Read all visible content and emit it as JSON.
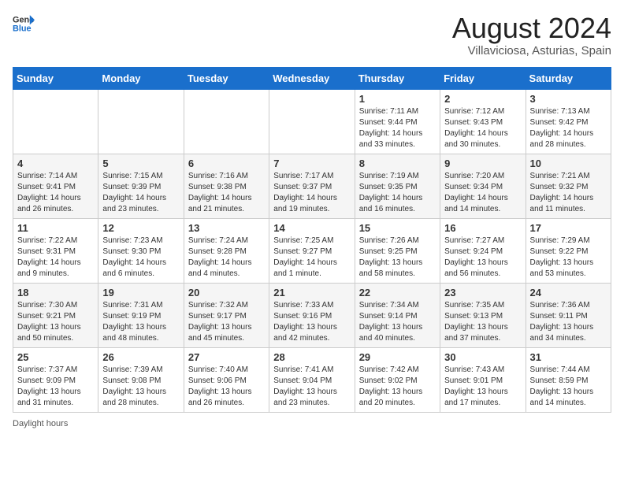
{
  "header": {
    "logo_general": "General",
    "logo_blue": "Blue",
    "month_year": "August 2024",
    "location": "Villaviciosa, Asturias, Spain"
  },
  "weekdays": [
    "Sunday",
    "Monday",
    "Tuesday",
    "Wednesday",
    "Thursday",
    "Friday",
    "Saturday"
  ],
  "footer_label": "Daylight hours",
  "weeks": [
    [
      {
        "day": "",
        "sunrise": "",
        "sunset": "",
        "daylight": ""
      },
      {
        "day": "",
        "sunrise": "",
        "sunset": "",
        "daylight": ""
      },
      {
        "day": "",
        "sunrise": "",
        "sunset": "",
        "daylight": ""
      },
      {
        "day": "",
        "sunrise": "",
        "sunset": "",
        "daylight": ""
      },
      {
        "day": "1",
        "sunrise": "Sunrise: 7:11 AM",
        "sunset": "Sunset: 9:44 PM",
        "daylight": "Daylight: 14 hours and 33 minutes."
      },
      {
        "day": "2",
        "sunrise": "Sunrise: 7:12 AM",
        "sunset": "Sunset: 9:43 PM",
        "daylight": "Daylight: 14 hours and 30 minutes."
      },
      {
        "day": "3",
        "sunrise": "Sunrise: 7:13 AM",
        "sunset": "Sunset: 9:42 PM",
        "daylight": "Daylight: 14 hours and 28 minutes."
      }
    ],
    [
      {
        "day": "4",
        "sunrise": "Sunrise: 7:14 AM",
        "sunset": "Sunset: 9:41 PM",
        "daylight": "Daylight: 14 hours and 26 minutes."
      },
      {
        "day": "5",
        "sunrise": "Sunrise: 7:15 AM",
        "sunset": "Sunset: 9:39 PM",
        "daylight": "Daylight: 14 hours and 23 minutes."
      },
      {
        "day": "6",
        "sunrise": "Sunrise: 7:16 AM",
        "sunset": "Sunset: 9:38 PM",
        "daylight": "Daylight: 14 hours and 21 minutes."
      },
      {
        "day": "7",
        "sunrise": "Sunrise: 7:17 AM",
        "sunset": "Sunset: 9:37 PM",
        "daylight": "Daylight: 14 hours and 19 minutes."
      },
      {
        "day": "8",
        "sunrise": "Sunrise: 7:19 AM",
        "sunset": "Sunset: 9:35 PM",
        "daylight": "Daylight: 14 hours and 16 minutes."
      },
      {
        "day": "9",
        "sunrise": "Sunrise: 7:20 AM",
        "sunset": "Sunset: 9:34 PM",
        "daylight": "Daylight: 14 hours and 14 minutes."
      },
      {
        "day": "10",
        "sunrise": "Sunrise: 7:21 AM",
        "sunset": "Sunset: 9:32 PM",
        "daylight": "Daylight: 14 hours and 11 minutes."
      }
    ],
    [
      {
        "day": "11",
        "sunrise": "Sunrise: 7:22 AM",
        "sunset": "Sunset: 9:31 PM",
        "daylight": "Daylight: 14 hours and 9 minutes."
      },
      {
        "day": "12",
        "sunrise": "Sunrise: 7:23 AM",
        "sunset": "Sunset: 9:30 PM",
        "daylight": "Daylight: 14 hours and 6 minutes."
      },
      {
        "day": "13",
        "sunrise": "Sunrise: 7:24 AM",
        "sunset": "Sunset: 9:28 PM",
        "daylight": "Daylight: 14 hours and 4 minutes."
      },
      {
        "day": "14",
        "sunrise": "Sunrise: 7:25 AM",
        "sunset": "Sunset: 9:27 PM",
        "daylight": "Daylight: 14 hours and 1 minute."
      },
      {
        "day": "15",
        "sunrise": "Sunrise: 7:26 AM",
        "sunset": "Sunset: 9:25 PM",
        "daylight": "Daylight: 13 hours and 58 minutes."
      },
      {
        "day": "16",
        "sunrise": "Sunrise: 7:27 AM",
        "sunset": "Sunset: 9:24 PM",
        "daylight": "Daylight: 13 hours and 56 minutes."
      },
      {
        "day": "17",
        "sunrise": "Sunrise: 7:29 AM",
        "sunset": "Sunset: 9:22 PM",
        "daylight": "Daylight: 13 hours and 53 minutes."
      }
    ],
    [
      {
        "day": "18",
        "sunrise": "Sunrise: 7:30 AM",
        "sunset": "Sunset: 9:21 PM",
        "daylight": "Daylight: 13 hours and 50 minutes."
      },
      {
        "day": "19",
        "sunrise": "Sunrise: 7:31 AM",
        "sunset": "Sunset: 9:19 PM",
        "daylight": "Daylight: 13 hours and 48 minutes."
      },
      {
        "day": "20",
        "sunrise": "Sunrise: 7:32 AM",
        "sunset": "Sunset: 9:17 PM",
        "daylight": "Daylight: 13 hours and 45 minutes."
      },
      {
        "day": "21",
        "sunrise": "Sunrise: 7:33 AM",
        "sunset": "Sunset: 9:16 PM",
        "daylight": "Daylight: 13 hours and 42 minutes."
      },
      {
        "day": "22",
        "sunrise": "Sunrise: 7:34 AM",
        "sunset": "Sunset: 9:14 PM",
        "daylight": "Daylight: 13 hours and 40 minutes."
      },
      {
        "day": "23",
        "sunrise": "Sunrise: 7:35 AM",
        "sunset": "Sunset: 9:13 PM",
        "daylight": "Daylight: 13 hours and 37 minutes."
      },
      {
        "day": "24",
        "sunrise": "Sunrise: 7:36 AM",
        "sunset": "Sunset: 9:11 PM",
        "daylight": "Daylight: 13 hours and 34 minutes."
      }
    ],
    [
      {
        "day": "25",
        "sunrise": "Sunrise: 7:37 AM",
        "sunset": "Sunset: 9:09 PM",
        "daylight": "Daylight: 13 hours and 31 minutes."
      },
      {
        "day": "26",
        "sunrise": "Sunrise: 7:39 AM",
        "sunset": "Sunset: 9:08 PM",
        "daylight": "Daylight: 13 hours and 28 minutes."
      },
      {
        "day": "27",
        "sunrise": "Sunrise: 7:40 AM",
        "sunset": "Sunset: 9:06 PM",
        "daylight": "Daylight: 13 hours and 26 minutes."
      },
      {
        "day": "28",
        "sunrise": "Sunrise: 7:41 AM",
        "sunset": "Sunset: 9:04 PM",
        "daylight": "Daylight: 13 hours and 23 minutes."
      },
      {
        "day": "29",
        "sunrise": "Sunrise: 7:42 AM",
        "sunset": "Sunset: 9:02 PM",
        "daylight": "Daylight: 13 hours and 20 minutes."
      },
      {
        "day": "30",
        "sunrise": "Sunrise: 7:43 AM",
        "sunset": "Sunset: 9:01 PM",
        "daylight": "Daylight: 13 hours and 17 minutes."
      },
      {
        "day": "31",
        "sunrise": "Sunrise: 7:44 AM",
        "sunset": "Sunset: 8:59 PM",
        "daylight": "Daylight: 13 hours and 14 minutes."
      }
    ]
  ]
}
